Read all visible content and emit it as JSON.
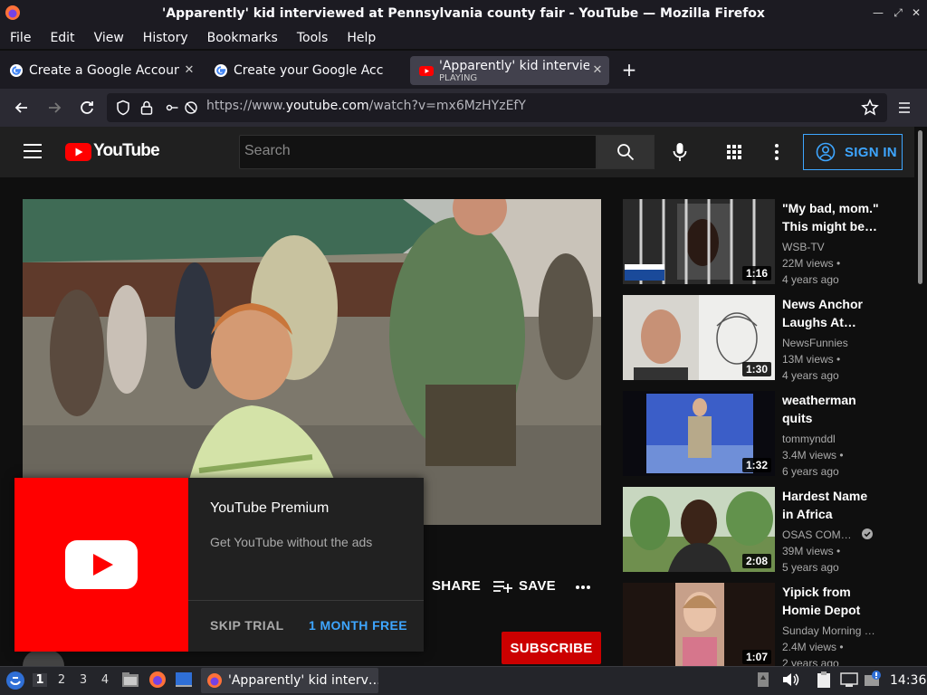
{
  "window": {
    "title": "'Apparently' kid interviewed at Pennsylvania county fair - YouTube — Mozilla Firefox"
  },
  "menu": [
    "File",
    "Edit",
    "View",
    "History",
    "Bookmarks",
    "Tools",
    "Help"
  ],
  "tabs": [
    {
      "label": "Create a Google Account",
      "favicon": "google-icon"
    },
    {
      "label": "Create your Google Account",
      "favicon": "google-icon"
    },
    {
      "label": "'Apparently' kid interviewed",
      "sublabel": "PLAYING",
      "favicon": "youtube-icon",
      "active": true
    }
  ],
  "url": {
    "prefix": "https://www.",
    "domain": "youtube.com",
    "path": "/watch?v=mx6MzHYzEfY"
  },
  "youtube": {
    "logo_text": "YouTube",
    "search_placeholder": "Search",
    "sign_in": "SIGN IN",
    "actions": {
      "share": "SHARE",
      "save": "SAVE"
    },
    "subscribe": "SUBSCRIBE",
    "promo": {
      "title": "YouTube Premium",
      "description": "Get YouTube without the ads",
      "skip": "SKIP TRIAL",
      "cta": "1 MONTH FREE"
    },
    "recommendations": [
      {
        "title": "\"My bad, mom.\" This might be…",
        "channel": "WSB-TV",
        "views": "22M views •",
        "age": "4 years ago",
        "duration": "1:16"
      },
      {
        "title": "News Anchor Laughs At…",
        "channel": "NewsFunnies",
        "views": "13M views •",
        "age": "4 years ago",
        "duration": "1:30"
      },
      {
        "title": "weatherman quits",
        "channel": "tommynddl",
        "views": "3.4M views •",
        "age": "6 years ago",
        "duration": "1:32"
      },
      {
        "title": "Hardest Name in Africa",
        "channel": "OSAS COM…",
        "views": "39M views •",
        "age": "5 years ago",
        "duration": "2:08",
        "verified": true
      },
      {
        "title": "Yipick from Homie Depot",
        "channel": "Sunday Morning …",
        "views": "2.4M views •",
        "age": "2 years ago",
        "duration": "1:07"
      }
    ]
  },
  "taskbar": {
    "workspaces": [
      "1",
      "2",
      "3",
      "4"
    ],
    "active_window": "'Apparently' kid interv…",
    "clock": "14:36"
  },
  "colors": {
    "youtube_red": "#ff0000",
    "subscribe_red": "#cc0000",
    "link_blue": "#3ea6ff"
  }
}
